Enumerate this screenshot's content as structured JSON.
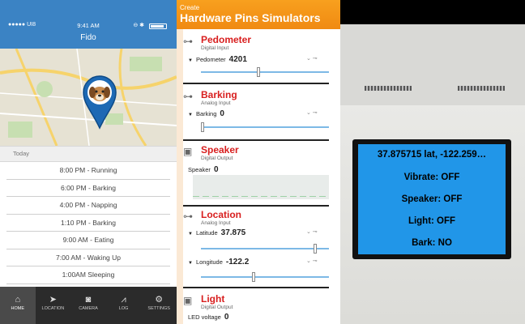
{
  "phone": {
    "status": {
      "carrier": "●●●●● UI8",
      "time": "9:41 AM",
      "lock": "⊖ ✱"
    },
    "title": "Fido",
    "section_header": "Today",
    "activities": [
      "8:00 PM - Running",
      "6:00 PM - Barking",
      "4:00 PM - Napping",
      "1:10 PM - Barking",
      "9:00 AM - Eating",
      "7:00 AM - Waking Up",
      "1:00AM Sleeping"
    ],
    "tabs": [
      {
        "label": "HOME",
        "icon": "home-icon",
        "glyph": "⌂"
      },
      {
        "label": "LOCATION",
        "icon": "location-arrow-icon",
        "glyph": "➤"
      },
      {
        "label": "CAMERA",
        "icon": "camera-icon",
        "glyph": "◙"
      },
      {
        "label": "LOG",
        "icon": "chart-icon",
        "glyph": "⩘"
      },
      {
        "label": "SETTINGS",
        "icon": "gear-icon",
        "glyph": "⚙"
      }
    ]
  },
  "simulator": {
    "header_small": "Create",
    "header_big": "Hardware Pins Simulators",
    "pedometer": {
      "title": "Pedometer",
      "sub": "Digital Input",
      "field": "Pedometer",
      "value": "4201",
      "slider": 0.45
    },
    "barking": {
      "title": "Barking",
      "sub": "Analog Input",
      "field": "Barking",
      "value": "0",
      "slider": 0.0
    },
    "speaker": {
      "title": "Speaker",
      "sub": "Digital Output",
      "field": "Speaker",
      "value": "0"
    },
    "location": {
      "title": "Location",
      "sub": "Analog Input",
      "lat_field": "Latitude",
      "lat_value": "37.875",
      "lat_slider": 0.9,
      "lon_field": "Longitude",
      "lon_value": "-122.2",
      "lon_slider": 0.41
    },
    "light": {
      "title": "Light",
      "sub": "Digital Output",
      "field": "LED voltage",
      "value": "0"
    }
  },
  "device": {
    "lcd_lines": [
      "37.875715 lat, -122.259…",
      "Vibrate: OFF",
      "Speaker: OFF",
      "Light: OFF",
      "Bark: NO"
    ]
  },
  "colors": {
    "phone_blue": "#3b83c4",
    "sim_orange": "#f39218",
    "section_red": "#d81e1e",
    "lcd_blue": "#2196e8"
  }
}
